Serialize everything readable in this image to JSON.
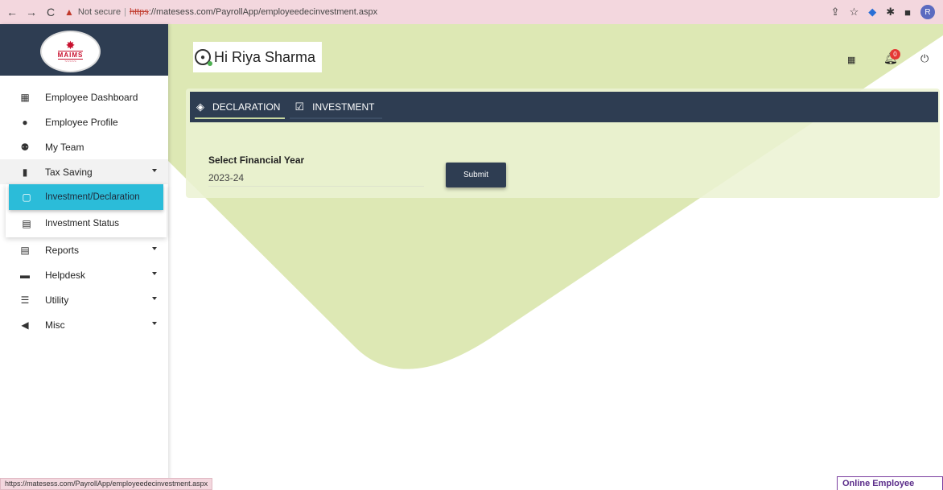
{
  "browser": {
    "back_icon": "←",
    "forward_icon": "→",
    "reload_icon": "C",
    "warning_icon": "▲",
    "not_secure": "Not secure",
    "url_https": "https",
    "url_rest": "://matesess.com/PayrollApp/employeedecinvestment.aspx",
    "profile_initial": "R"
  },
  "sidebar": {
    "logo_text": "MAIMS",
    "items": [
      {
        "label": "Employee Dashboard",
        "icon": "grid-icon"
      },
      {
        "label": "Employee Profile",
        "icon": "user-icon"
      },
      {
        "label": "My Team",
        "icon": "users-icon"
      },
      {
        "label": "Tax Saving",
        "icon": "book-icon",
        "expandable": true,
        "expanded": true
      },
      {
        "label": "Reports",
        "icon": "report-icon",
        "expandable": true
      },
      {
        "label": "Helpdesk",
        "icon": "laptop-icon",
        "expandable": true
      },
      {
        "label": "Utility",
        "icon": "list-icon",
        "expandable": true
      },
      {
        "label": "Misc",
        "icon": "megaphone-icon",
        "expandable": true
      }
    ],
    "submenu": [
      {
        "label": "Investment/Declaration",
        "active": true
      },
      {
        "label": "Investment Status",
        "active": false
      }
    ]
  },
  "header": {
    "greeting": "Hi Riya Sharma",
    "notification_count": "0"
  },
  "tabs": [
    {
      "label": "DECLARATION",
      "active": true
    },
    {
      "label": "INVESTMENT",
      "active": false
    }
  ],
  "form": {
    "fy_label": "Select Financial Year",
    "fy_value": "2023-24",
    "submit_label": "Submit"
  },
  "statusbar": {
    "url": "https://matesess.com/PayrollApp/employeedecinvestment.aspx"
  },
  "online_widget": {
    "label": "Online Employee"
  },
  "colors": {
    "sidebar_header": "#2e3d52",
    "accent_active": "#2bbcd9",
    "wedge": "#dde8b4",
    "browser_chrome": "#f3d7de"
  }
}
